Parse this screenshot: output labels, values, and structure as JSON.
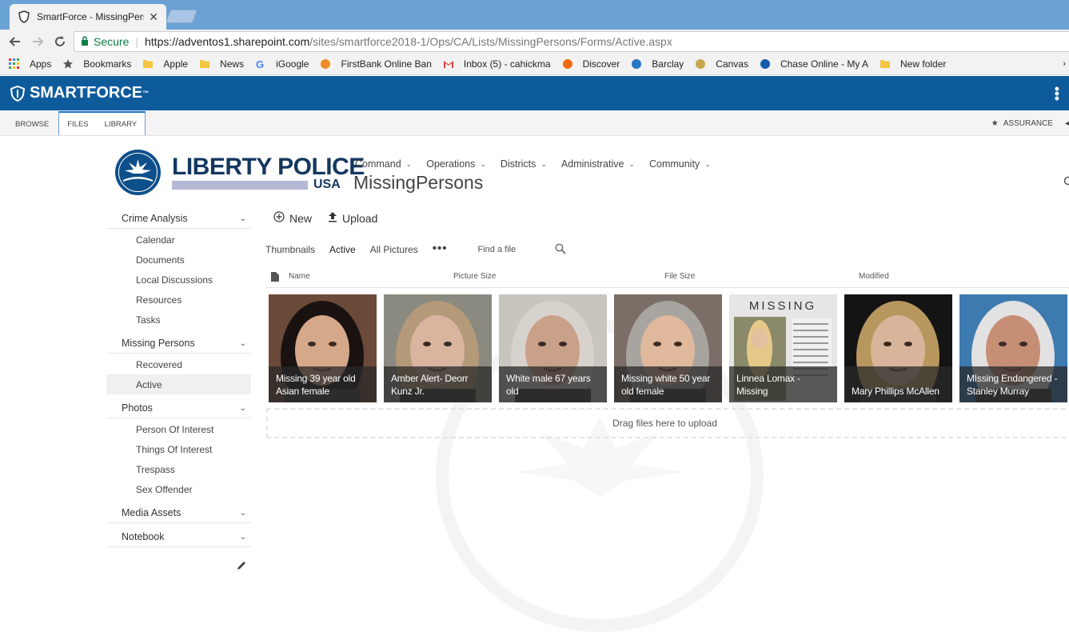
{
  "browser": {
    "tab_title": "SmartForce - MissingPers",
    "tab_close": "✕",
    "secure_label": "Secure",
    "url_host": "https://adventos1.sharepoint.com",
    "url_path": "/sites/smartforce2018-1/Ops/CA/Lists/MissingPersons/Forms/Active.aspx"
  },
  "bookmarks": [
    {
      "label": "Apps",
      "icon": "apps-grid-icon",
      "color": "#e33"
    },
    {
      "label": "Bookmarks",
      "icon": "star-icon",
      "color": "#555"
    },
    {
      "label": "Apple",
      "icon": "folder-icon",
      "color": "#f4c542"
    },
    {
      "label": "News",
      "icon": "folder-icon",
      "color": "#f4c542"
    },
    {
      "label": "iGoogle",
      "icon": "google-icon",
      "color": "#4285f4"
    },
    {
      "label": "FirstBank Online Ban",
      "icon": "firstbank-icon",
      "color": "#f08a24"
    },
    {
      "label": "Inbox (5) - cahickma",
      "icon": "gmail-icon",
      "color": "#d44"
    },
    {
      "label": "Discover",
      "icon": "discover-icon",
      "color": "#f26b11"
    },
    {
      "label": "Barclay",
      "icon": "barclay-icon",
      "color": "#2a76c6"
    },
    {
      "label": "Canvas",
      "icon": "canvas-icon",
      "color": "#c8a64b"
    },
    {
      "label": "Chase Online - My A",
      "icon": "chase-icon",
      "color": "#1a5dab"
    },
    {
      "label": "New folder",
      "icon": "folder-icon",
      "color": "#f4c542"
    }
  ],
  "smartforce": {
    "logo_text": "SMARTFORCE",
    "tm": "™"
  },
  "ribbon": {
    "browse": "BROWSE",
    "files": "FILES",
    "library": "LIBRARY",
    "assurance": "ASSURANCE"
  },
  "site": {
    "brand_title": "LIBERTY POLICE",
    "brand_usa": "USA",
    "page_title": "MissingPersons",
    "nav": [
      {
        "label": "Command"
      },
      {
        "label": "Operations"
      },
      {
        "label": "Districts"
      },
      {
        "label": "Administrative"
      },
      {
        "label": "Community"
      }
    ]
  },
  "leftnav": {
    "crime_analysis": "Crime Analysis",
    "crime_items": [
      "Calendar",
      "Documents",
      "Local Discussions",
      "Resources",
      "Tasks"
    ],
    "missing_persons": "Missing Persons",
    "missing_items": [
      "Recovered",
      "Active"
    ],
    "photos": "Photos",
    "photo_items": [
      "Person Of Interest",
      "Things Of Interest",
      "Trespass",
      "Sex Offender"
    ],
    "media_assets": "Media Assets",
    "notebook": "Notebook"
  },
  "commands": {
    "new_label": "New",
    "upload_label": "Upload"
  },
  "views": {
    "thumbnails": "Thumbnails",
    "active": "Active",
    "all_pictures": "All Pictures",
    "more": "•••",
    "find_placeholder": "Find a file"
  },
  "columns": {
    "name": "Name",
    "picture_size": "Picture Size",
    "file_size": "File Size",
    "modified": "Modified"
  },
  "thumbnails": [
    {
      "caption": "Missing 39 year old Asian female",
      "bg": "#6b4a3a",
      "face": "#d6a88a",
      "hair": "#1a1210"
    },
    {
      "caption": "Amber Alert- Deorr Kunz Jr.",
      "bg": "#8a8a80",
      "face": "#d9b49e",
      "hair": "#b59a7a"
    },
    {
      "caption": "White male 67 years old",
      "bg": "#c8c4be",
      "face": "#c9a08a",
      "hair": "#d8d2cc"
    },
    {
      "caption": "Missing white 50 year old female",
      "bg": "#7a6e66",
      "face": "#e0b89c",
      "hair": "#a8a4a0"
    },
    {
      "caption": "Linnea Lomax - Missing",
      "bg": "#e6e6e6",
      "face": "#e2c0a0",
      "hair": "#e6c98a",
      "poster_title": "MISSING"
    },
    {
      "caption": "Mary Phillips McAllen",
      "bg": "#141414",
      "face": "#d8b49a",
      "hair": "#b8975e"
    },
    {
      "caption": "MIssing Endangered - Stanley Murray",
      "bg": "#3c7ab0",
      "face": "#c78e76",
      "hair": "#e2e2e2"
    }
  ],
  "dropzone": {
    "label": "Drag files here to upload"
  }
}
